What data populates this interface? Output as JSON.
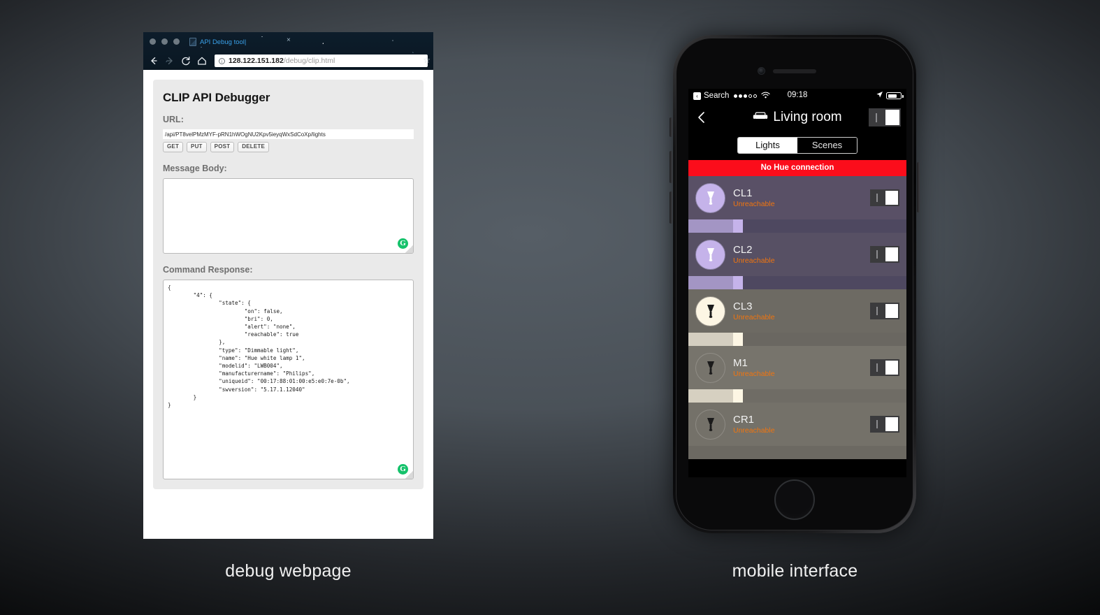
{
  "captions": {
    "left": "debug webpage",
    "right": "mobile interface"
  },
  "browser": {
    "tab_title": "API Debug tool|",
    "tab_close": "×",
    "url_host": "128.122.151.182",
    "url_path": "/debug/clip.html",
    "star_glyph": "☆",
    "page": {
      "app_title": "CLIP API Debugger",
      "url_label": "URL:",
      "url_value": "/api/PT8velPMzMYF-pRN1hWOgNU2Kpv5ieyqWxSdCoXp/lights",
      "url_placeholder": "/api/",
      "verbs": [
        "GET",
        "PUT",
        "POST",
        "DELETE"
      ],
      "message_body_label": "Message Body:",
      "message_body_value": "",
      "message_body_placeholder": "",
      "command_response_label": "Command Response:",
      "command_response_value": "{\n        \"4\": {\n                \"state\": {\n                        \"on\": false,\n                        \"bri\": 0,\n                        \"alert\": \"none\",\n                        \"reachable\": true\n                },\n                \"type\": \"Dimmable light\",\n                \"name\": \"Hue white lamp 1\",\n                \"modelid\": \"LWB004\",\n                \"manufacturername\": \"Philips\",\n                \"uniqueid\": \"00:17:88:01:00:e5:e0:7e-0b\",\n                \"swversion\": \"5.17.1.12040\"\n        }\n}",
      "grammarly_badge": "G"
    }
  },
  "phone": {
    "statusbar": {
      "back_glyph": "‹",
      "carrier_label": "Search",
      "signal_dots": [
        true,
        true,
        true,
        false,
        false
      ],
      "time": "09:18",
      "location_glyph": "➤",
      "battery_percent": 72
    },
    "appbar": {
      "back_label": "‹",
      "room_icon": "couch-icon",
      "title": "Living room",
      "toggle_bar": "I"
    },
    "segment": {
      "tabs": [
        {
          "label": "Lights",
          "active": true
        },
        {
          "label": "Scenes",
          "active": false
        }
      ]
    },
    "banner": {
      "text": "No Hue connection",
      "color": "#fb0d1b"
    },
    "status_color": "#f0750f",
    "lights": [
      {
        "name": "CL1",
        "status": "Unreachable",
        "bulb_fill": "#c5b3ea",
        "bulb_glyph_color": "#ffffff",
        "bulb_ring": "#8d84a8",
        "row_bg": "#595066",
        "slider_track": "#4e4860",
        "slider_fill": "#c5b3ea",
        "slider_value": 25
      },
      {
        "name": "CL2",
        "status": "Unreachable",
        "bulb_fill": "#c5b3ea",
        "bulb_glyph_color": "#ffffff",
        "bulb_ring": "#8d84a8",
        "row_bg": "#575064",
        "slider_track": "#4e4860",
        "slider_fill": "#c5b3ea",
        "slider_value": 25
      },
      {
        "name": "CL3",
        "status": "Unreachable",
        "bulb_fill": "#fdf6e4",
        "bulb_glyph_color": "#1b1b1b",
        "bulb_ring": "#9b968d",
        "row_bg": "#6d6a63",
        "slider_track": "#6a6761",
        "slider_fill": "#fdf6e4",
        "slider_value": 25
      },
      {
        "name": "M1",
        "status": "Unreachable",
        "bulb_fill": "transparent",
        "bulb_glyph_color": "#1b1b1b",
        "bulb_ring": "#908d86",
        "row_bg": "#77746c",
        "slider_track": "#6f6c65",
        "slider_fill": "#fdf6e4",
        "slider_value": 25
      },
      {
        "name": "CR1",
        "status": "Unreachable",
        "bulb_fill": "transparent",
        "bulb_glyph_color": "#1b1b1b",
        "bulb_ring": "#8e8b84",
        "row_bg": "#747169",
        "slider_track": "#6c6962",
        "slider_fill": "#fdf6e4",
        "slider_value": 0
      }
    ]
  }
}
